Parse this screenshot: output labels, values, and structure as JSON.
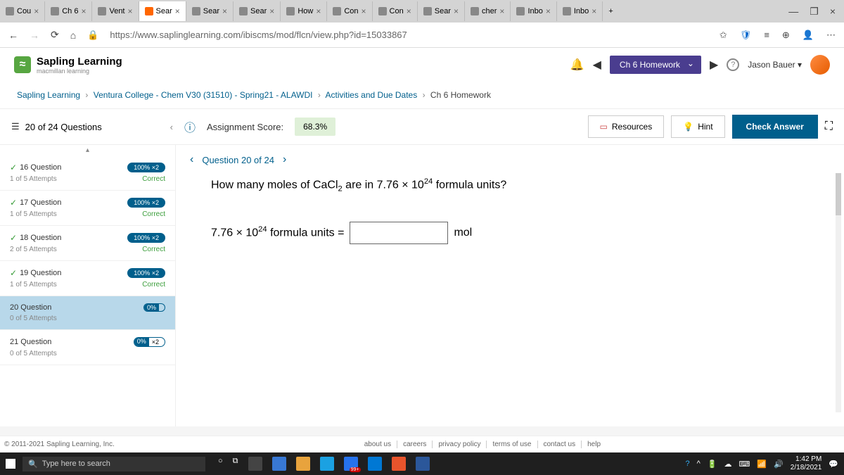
{
  "browser": {
    "tabs": [
      "Cou",
      "Ch 6",
      "Vent",
      "Sear",
      "Sear",
      "Sear",
      "How",
      "Con",
      "Con",
      "Sear",
      "cher",
      "Inbo",
      "Inbo"
    ],
    "url": "https://www.saplinglearning.com/ibiscms/mod/flcn/view.php?id=15033867"
  },
  "header": {
    "app_name": "Sapling Learning",
    "app_sub": "macmillan learning",
    "hw_label": "Ch 6 Homework",
    "user": "Jason Bauer"
  },
  "breadcrumb": {
    "parts": [
      "Sapling Learning",
      "Ventura College - Chem V30 (31510) - Spring21 - ALAWDI",
      "Activities and Due Dates"
    ],
    "current": "Ch 6 Homework"
  },
  "toolbar": {
    "counter": "20 of 24 Questions",
    "score_label": "Assignment Score:",
    "score_value": "68.3%",
    "resources": "Resources",
    "hint": "Hint",
    "check": "Check Answer"
  },
  "sidebar": {
    "items": [
      {
        "title": "16 Question",
        "pct": "100%",
        "mult": "×2",
        "attempts": "1 of 5 Attempts",
        "status": "Correct",
        "done": true
      },
      {
        "title": "17 Question",
        "pct": "100%",
        "mult": "×2",
        "attempts": "1 of 5 Attempts",
        "status": "Correct",
        "done": true
      },
      {
        "title": "18 Question",
        "pct": "100%",
        "mult": "×2",
        "attempts": "2 of 5 Attempts",
        "status": "Correct",
        "done": true
      },
      {
        "title": "19 Question",
        "pct": "100%",
        "mult": "×2",
        "attempts": "1 of 5 Attempts",
        "status": "Correct",
        "done": true
      },
      {
        "title": "20 Question",
        "pct": "0%",
        "mult": "",
        "attempts": "0 of 5 Attempts",
        "status": "",
        "done": false,
        "active": true
      },
      {
        "title": "21 Question",
        "pct": "0%",
        "mult": "×2",
        "attempts": "0 of 5 Attempts",
        "status": "",
        "done": false
      }
    ]
  },
  "content": {
    "nav_label": "Question 20 of 24",
    "prompt_pre": "How many moles of CaCl",
    "prompt_mid": " are in 7.76 × 10",
    "prompt_post": " formula units?",
    "answer_lhs_pre": "7.76 × 10",
    "answer_lhs_post": " formula units =",
    "unit": "mol"
  },
  "footer": {
    "copyright": "© 2011-2021 Sapling Learning, Inc.",
    "links": [
      "about us",
      "careers",
      "privacy policy",
      "terms of use",
      "contact us",
      "help"
    ]
  },
  "taskbar": {
    "search_placeholder": "Type here to search",
    "badge": "99+",
    "time": "1:42 PM",
    "date": "2/18/2021"
  }
}
